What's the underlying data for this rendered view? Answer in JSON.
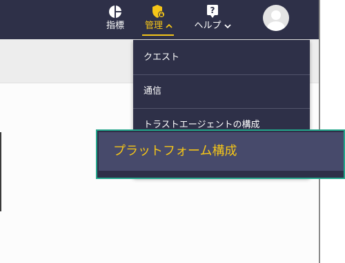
{
  "header": {
    "nav": {
      "metrics": {
        "label": "指標",
        "icon": "pie-chart-icon"
      },
      "admin": {
        "label": "管理",
        "icon": "shield-lock-icon",
        "chevron": "chevron-up-icon",
        "active_color": "#f5c518"
      },
      "help": {
        "label": "ヘルプ",
        "icon": "help-icon",
        "chevron": "chevron-down-icon"
      }
    },
    "avatar": {
      "icon": "user-avatar-icon"
    }
  },
  "admin_menu": {
    "items": [
      {
        "label": "クエスト"
      },
      {
        "label": "通信"
      },
      {
        "label": "トラストエージェントの構成"
      },
      {
        "label": "プラットフォーム構成",
        "highlighted": true
      }
    ]
  },
  "colors": {
    "navbar_bg": "#2e3048",
    "accent": "#f5c518",
    "highlight_border": "#22a58a",
    "highlight_bg": "#474a6b"
  }
}
